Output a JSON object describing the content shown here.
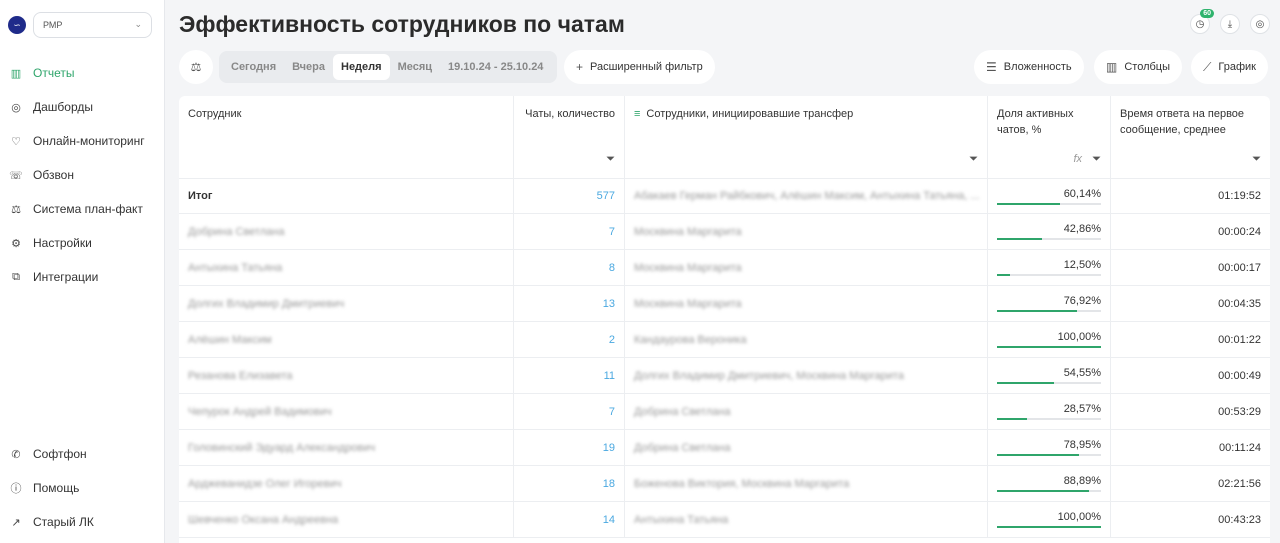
{
  "sidebar": {
    "org_select": "РМР",
    "nav_top": [
      {
        "label": "Отчеты",
        "icon": "reports-icon",
        "glyph": "▥",
        "active": true
      },
      {
        "label": "Дашборды",
        "icon": "dashboard-icon",
        "glyph": "◎",
        "active": false
      },
      {
        "label": "Онлайн-мониторинг",
        "icon": "monitoring-icon",
        "glyph": "♡",
        "active": false
      },
      {
        "label": "Обзвон",
        "icon": "calls-icon",
        "glyph": "☏",
        "active": false
      },
      {
        "label": "Система план-факт",
        "icon": "plan-fact-icon",
        "glyph": "⚖",
        "active": false
      },
      {
        "label": "Настройки",
        "icon": "settings-icon",
        "glyph": "⚙",
        "active": false
      },
      {
        "label": "Интеграции",
        "icon": "integrations-icon",
        "glyph": "⧉",
        "active": false
      }
    ],
    "nav_bottom": [
      {
        "label": "Софтфон",
        "icon": "phone-icon",
        "glyph": "✆"
      },
      {
        "label": "Помощь",
        "icon": "help-icon",
        "glyph": "ⓘ"
      },
      {
        "label": "Старый ЛК",
        "icon": "external-link-icon",
        "glyph": "↗"
      }
    ]
  },
  "header": {
    "title": "Эффективность сотрудников по чатам",
    "notification_count": "60"
  },
  "toolbar": {
    "periods": [
      {
        "label": "Сегодня",
        "active": false
      },
      {
        "label": "Вчера",
        "active": false
      },
      {
        "label": "Неделя",
        "active": true
      },
      {
        "label": "Месяц",
        "active": false
      },
      {
        "label": "19.10.24 - 25.10.24",
        "active": false
      }
    ],
    "advanced_filter": "Расширенный фильтр",
    "nesting": "Вложенность",
    "columns": "Столбцы",
    "chart": "График"
  },
  "table": {
    "headers": {
      "employee": "Сотрудник",
      "chats_count": "Чаты, количество",
      "transfer": "Сотрудники, инициировавшие трансфер",
      "active_share": "Доля активных чатов, %",
      "first_response": "Время ответа на первое сообщение, среднее"
    },
    "total": {
      "label": "Итог",
      "chats": "577",
      "transfer": "Абакаев Герман Райбкович, Алёшин Максим, Антыхина Татьяна, ...",
      "share": "60,14%",
      "share_value": 60.14,
      "time": "01:19:52"
    },
    "rows": [
      {
        "name": "Добрина Светлана",
        "chats": "7",
        "transfer": "Москвина Маргарита",
        "share": "42,86%",
        "share_value": 42.86,
        "time": "00:00:24"
      },
      {
        "name": "Антыхина Татьяна",
        "chats": "8",
        "transfer": "Москвина Маргарита",
        "share": "12,50%",
        "share_value": 12.5,
        "time": "00:00:17"
      },
      {
        "name": "Долгих Владимир Дмитриевич",
        "chats": "13",
        "transfer": "Москвина Маргарита",
        "share": "76,92%",
        "share_value": 76.92,
        "time": "00:04:35"
      },
      {
        "name": "Алёшин Максим",
        "chats": "2",
        "transfer": "Кандаурова Вероника",
        "share": "100,00%",
        "share_value": 100,
        "time": "00:01:22"
      },
      {
        "name": "Резанова Елизавета",
        "chats": "11",
        "transfer": "Долгих Владимир Дмитриевич, Москвина Маргарита",
        "share": "54,55%",
        "share_value": 54.55,
        "time": "00:00:49"
      },
      {
        "name": "Чепурок Андрей Вадимович",
        "chats": "7",
        "transfer": "Добрина Светлана",
        "share": "28,57%",
        "share_value": 28.57,
        "time": "00:53:29"
      },
      {
        "name": "Головинский Эдуард Александрович",
        "chats": "19",
        "transfer": "Добрина Светлана",
        "share": "78,95%",
        "share_value": 78.95,
        "time": "00:11:24"
      },
      {
        "name": "Арджеванидзе Олег Игоревич",
        "chats": "18",
        "transfer": "Боженова Виктория, Москвина Маргарита",
        "share": "88,89%",
        "share_value": 88.89,
        "time": "02:21:56"
      },
      {
        "name": "Шевченко Оксана Андреевна",
        "chats": "14",
        "transfer": "Антыхина Татьяна",
        "share": "100,00%",
        "share_value": 100,
        "time": "00:43:23"
      }
    ]
  },
  "colors": {
    "accent": "#2fa56b",
    "link": "#4aa8e0"
  }
}
